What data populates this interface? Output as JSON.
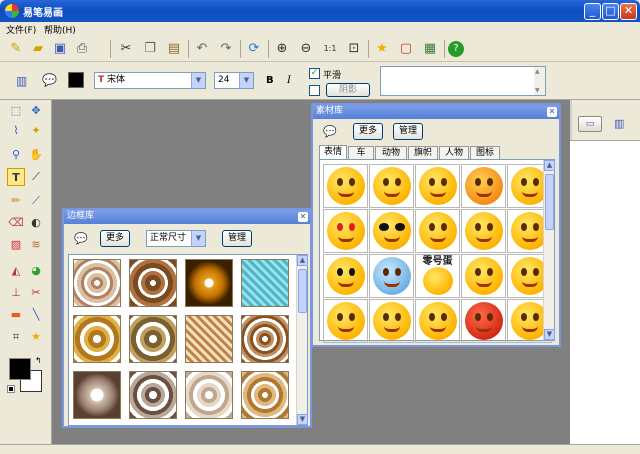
{
  "window": {
    "title": "易笔易画"
  },
  "menu": [
    {
      "label": "文件(F)"
    },
    {
      "label": "帮助(H)"
    }
  ],
  "toolbar2": {
    "font_name": "宋体",
    "font_size": "24",
    "bold_label": "B",
    "italic_label": "I",
    "smooth_label": "平滑",
    "smooth_checked": true,
    "shadow_label": "阴影",
    "color": "#000000"
  },
  "material_panel": {
    "title": "素材库",
    "more_label": "更多",
    "manage_label": "管理",
    "tabs": [
      {
        "label": "表情"
      },
      {
        "label": "车"
      },
      {
        "label": "动物"
      },
      {
        "label": "旗帜"
      },
      {
        "label": "人物"
      },
      {
        "label": "图标"
      }
    ],
    "active_tab": 0,
    "bubble_text": "零号蛋"
  },
  "frame_panel": {
    "title": "边框库",
    "more_label": "更多",
    "size_option": "正常尺寸",
    "manage_label": "管理"
  },
  "colors": {
    "titlebar": "#0a4ec0",
    "canvas": "#808080",
    "panel_border": "#7a96df",
    "foreground": "#000000",
    "background": "#ffffff"
  }
}
